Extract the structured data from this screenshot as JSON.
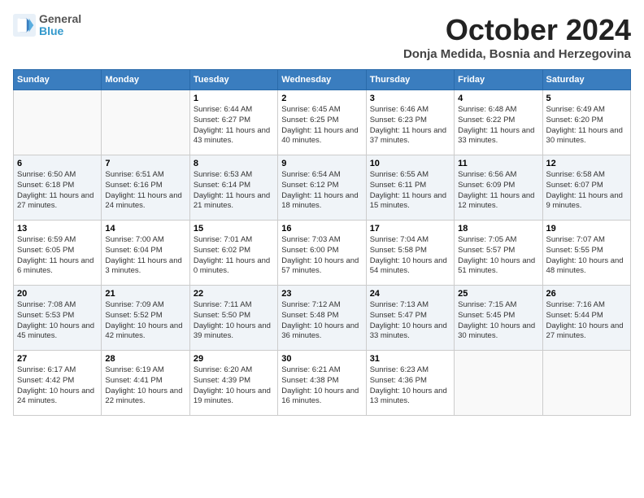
{
  "header": {
    "logo_general": "General",
    "logo_blue": "Blue",
    "month": "October 2024",
    "location": "Donja Medida, Bosnia and Herzegovina"
  },
  "days_of_week": [
    "Sunday",
    "Monday",
    "Tuesday",
    "Wednesday",
    "Thursday",
    "Friday",
    "Saturday"
  ],
  "weeks": [
    [
      {
        "day": "",
        "detail": ""
      },
      {
        "day": "",
        "detail": ""
      },
      {
        "day": "1",
        "detail": "Sunrise: 6:44 AM\nSunset: 6:27 PM\nDaylight: 11 hours and 43 minutes."
      },
      {
        "day": "2",
        "detail": "Sunrise: 6:45 AM\nSunset: 6:25 PM\nDaylight: 11 hours and 40 minutes."
      },
      {
        "day": "3",
        "detail": "Sunrise: 6:46 AM\nSunset: 6:23 PM\nDaylight: 11 hours and 37 minutes."
      },
      {
        "day": "4",
        "detail": "Sunrise: 6:48 AM\nSunset: 6:22 PM\nDaylight: 11 hours and 33 minutes."
      },
      {
        "day": "5",
        "detail": "Sunrise: 6:49 AM\nSunset: 6:20 PM\nDaylight: 11 hours and 30 minutes."
      }
    ],
    [
      {
        "day": "6",
        "detail": "Sunrise: 6:50 AM\nSunset: 6:18 PM\nDaylight: 11 hours and 27 minutes."
      },
      {
        "day": "7",
        "detail": "Sunrise: 6:51 AM\nSunset: 6:16 PM\nDaylight: 11 hours and 24 minutes."
      },
      {
        "day": "8",
        "detail": "Sunrise: 6:53 AM\nSunset: 6:14 PM\nDaylight: 11 hours and 21 minutes."
      },
      {
        "day": "9",
        "detail": "Sunrise: 6:54 AM\nSunset: 6:12 PM\nDaylight: 11 hours and 18 minutes."
      },
      {
        "day": "10",
        "detail": "Sunrise: 6:55 AM\nSunset: 6:11 PM\nDaylight: 11 hours and 15 minutes."
      },
      {
        "day": "11",
        "detail": "Sunrise: 6:56 AM\nSunset: 6:09 PM\nDaylight: 11 hours and 12 minutes."
      },
      {
        "day": "12",
        "detail": "Sunrise: 6:58 AM\nSunset: 6:07 PM\nDaylight: 11 hours and 9 minutes."
      }
    ],
    [
      {
        "day": "13",
        "detail": "Sunrise: 6:59 AM\nSunset: 6:05 PM\nDaylight: 11 hours and 6 minutes."
      },
      {
        "day": "14",
        "detail": "Sunrise: 7:00 AM\nSunset: 6:04 PM\nDaylight: 11 hours and 3 minutes."
      },
      {
        "day": "15",
        "detail": "Sunrise: 7:01 AM\nSunset: 6:02 PM\nDaylight: 11 hours and 0 minutes."
      },
      {
        "day": "16",
        "detail": "Sunrise: 7:03 AM\nSunset: 6:00 PM\nDaylight: 10 hours and 57 minutes."
      },
      {
        "day": "17",
        "detail": "Sunrise: 7:04 AM\nSunset: 5:58 PM\nDaylight: 10 hours and 54 minutes."
      },
      {
        "day": "18",
        "detail": "Sunrise: 7:05 AM\nSunset: 5:57 PM\nDaylight: 10 hours and 51 minutes."
      },
      {
        "day": "19",
        "detail": "Sunrise: 7:07 AM\nSunset: 5:55 PM\nDaylight: 10 hours and 48 minutes."
      }
    ],
    [
      {
        "day": "20",
        "detail": "Sunrise: 7:08 AM\nSunset: 5:53 PM\nDaylight: 10 hours and 45 minutes."
      },
      {
        "day": "21",
        "detail": "Sunrise: 7:09 AM\nSunset: 5:52 PM\nDaylight: 10 hours and 42 minutes."
      },
      {
        "day": "22",
        "detail": "Sunrise: 7:11 AM\nSunset: 5:50 PM\nDaylight: 10 hours and 39 minutes."
      },
      {
        "day": "23",
        "detail": "Sunrise: 7:12 AM\nSunset: 5:48 PM\nDaylight: 10 hours and 36 minutes."
      },
      {
        "day": "24",
        "detail": "Sunrise: 7:13 AM\nSunset: 5:47 PM\nDaylight: 10 hours and 33 minutes."
      },
      {
        "day": "25",
        "detail": "Sunrise: 7:15 AM\nSunset: 5:45 PM\nDaylight: 10 hours and 30 minutes."
      },
      {
        "day": "26",
        "detail": "Sunrise: 7:16 AM\nSunset: 5:44 PM\nDaylight: 10 hours and 27 minutes."
      }
    ],
    [
      {
        "day": "27",
        "detail": "Sunrise: 6:17 AM\nSunset: 4:42 PM\nDaylight: 10 hours and 24 minutes."
      },
      {
        "day": "28",
        "detail": "Sunrise: 6:19 AM\nSunset: 4:41 PM\nDaylight: 10 hours and 22 minutes."
      },
      {
        "day": "29",
        "detail": "Sunrise: 6:20 AM\nSunset: 4:39 PM\nDaylight: 10 hours and 19 minutes."
      },
      {
        "day": "30",
        "detail": "Sunrise: 6:21 AM\nSunset: 4:38 PM\nDaylight: 10 hours and 16 minutes."
      },
      {
        "day": "31",
        "detail": "Sunrise: 6:23 AM\nSunset: 4:36 PM\nDaylight: 10 hours and 13 minutes."
      },
      {
        "day": "",
        "detail": ""
      },
      {
        "day": "",
        "detail": ""
      }
    ]
  ]
}
